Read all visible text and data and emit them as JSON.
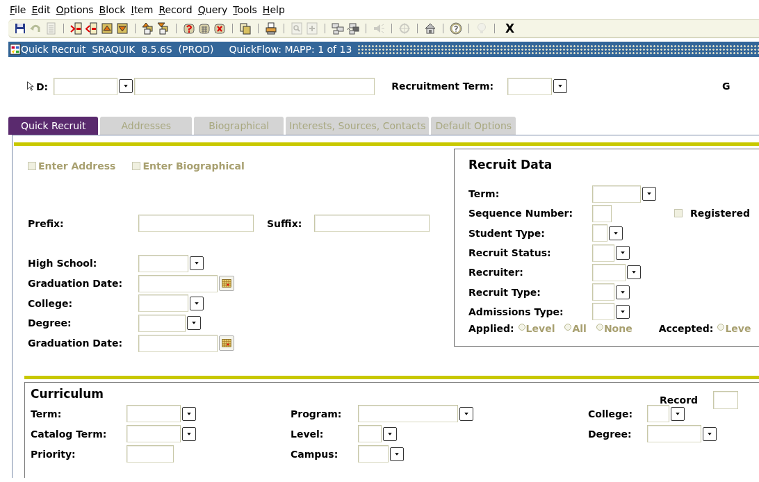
{
  "menu": [
    "File",
    "Edit",
    "Options",
    "Block",
    "Item",
    "Record",
    "Query",
    "Tools",
    "Help"
  ],
  "toolbar": {
    "groups": [
      [
        {
          "kind": "floppy",
          "disabled": false
        },
        {
          "kind": "curved-arrow",
          "disabled": true
        },
        {
          "kind": "document",
          "disabled": true
        }
      ],
      [
        {
          "kind": "page-arrow-in",
          "disabled": false
        },
        {
          "kind": "page-arrow-out",
          "disabled": false
        },
        {
          "kind": "box-up",
          "disabled": false
        },
        {
          "kind": "box-down",
          "disabled": false
        }
      ],
      [
        {
          "kind": "stack-up",
          "disabled": false
        },
        {
          "kind": "stack-down",
          "disabled": false
        }
      ],
      [
        {
          "kind": "drum-question",
          "disabled": false
        },
        {
          "kind": "drum-grid",
          "disabled": false
        },
        {
          "kind": "drum-x",
          "disabled": false
        }
      ],
      [
        {
          "kind": "documents",
          "disabled": false
        }
      ],
      [
        {
          "kind": "printer",
          "disabled": false
        }
      ],
      [
        {
          "kind": "magnifier",
          "disabled": true
        },
        {
          "kind": "plus",
          "disabled": true
        }
      ],
      [
        {
          "kind": "boxes",
          "disabled": false
        },
        {
          "kind": "boxes-x",
          "disabled": false
        }
      ],
      [
        {
          "kind": "speaker",
          "disabled": true
        }
      ],
      [
        {
          "kind": "crosshair",
          "disabled": true
        }
      ],
      [
        {
          "kind": "house",
          "disabled": false
        }
      ],
      [
        {
          "kind": "question",
          "disabled": false
        }
      ],
      [
        {
          "kind": "bulb",
          "disabled": true
        }
      ]
    ],
    "exit": "X"
  },
  "title_bar": {
    "text": "Quick Recruit  SRAQUIK  8.5.6S  (PROD)",
    "quickflow": "QuickFlow: MAPP: 1 of 13"
  },
  "key_block": {
    "id_label": "D:",
    "recruitment_term_label": "Recruitment Term:",
    "cut_label": "G"
  },
  "tabs": [
    {
      "label": "Quick Recruit",
      "selected": true
    },
    {
      "label": "Addresses",
      "selected": false
    },
    {
      "label": "Biographical",
      "selected": false
    },
    {
      "label": "Interests, Sources, Contacts",
      "selected": false
    },
    {
      "label": "Default Options",
      "selected": false
    }
  ],
  "options": [
    {
      "label": "Enter Address",
      "checked": false,
      "disabled": true
    },
    {
      "label": "Enter Biographical",
      "checked": false,
      "disabled": true
    }
  ],
  "name_fields": [
    {
      "label": "Prefix:",
      "kind": "text"
    },
    {
      "label": "Suffix:",
      "kind": "text"
    }
  ],
  "school_fields": [
    {
      "label": "High School:",
      "kind": "lov"
    },
    {
      "label": "Graduation Date:",
      "kind": "date"
    },
    {
      "label": "College:",
      "kind": "lov"
    },
    {
      "label": "Degree:",
      "kind": "lov"
    },
    {
      "label": "Graduation Date:",
      "kind": "date"
    }
  ],
  "recruit_data": {
    "title": "Recruit Data",
    "fields": [
      {
        "label": "Term:",
        "kind": "lov"
      },
      {
        "label": "Sequence Number:",
        "kind": "text"
      },
      {
        "label": "Student Type:",
        "kind": "lov"
      },
      {
        "label": "Recruit Status:",
        "kind": "lov"
      },
      {
        "label": "Recruiter:",
        "kind": "lov"
      },
      {
        "label": "Recruit Type:",
        "kind": "lov"
      },
      {
        "label": "Admissions Type:",
        "kind": "lov"
      }
    ],
    "registered": {
      "label": "Registered",
      "checked": false,
      "disabled": false
    },
    "applied": {
      "label": "Applied:",
      "options": [
        {
          "label": "Level",
          "selected": false,
          "disabled": true
        },
        {
          "label": "All",
          "selected": false,
          "disabled": true
        },
        {
          "label": "None",
          "selected": false,
          "disabled": true
        }
      ]
    },
    "accepted": {
      "label": "Accepted:",
      "options": [
        {
          "label": "Leve",
          "selected": false,
          "disabled": true
        }
      ]
    }
  },
  "curriculum": {
    "title": "Curriculum",
    "record_label": "Record",
    "rows": [
      [
        {
          "label": "Term:",
          "kind": "lov"
        },
        {
          "label": "Program:",
          "kind": "lov"
        },
        {
          "label": "College:",
          "kind": "lov"
        }
      ],
      [
        {
          "label": "Catalog Term:",
          "kind": "lov"
        },
        {
          "label": "Level:",
          "kind": "lov"
        },
        {
          "label": "Degree:",
          "kind": "lov"
        }
      ],
      [
        {
          "label": "Priority:",
          "kind": "text"
        },
        {
          "label": "Campus:",
          "kind": "lov"
        }
      ]
    ]
  }
}
